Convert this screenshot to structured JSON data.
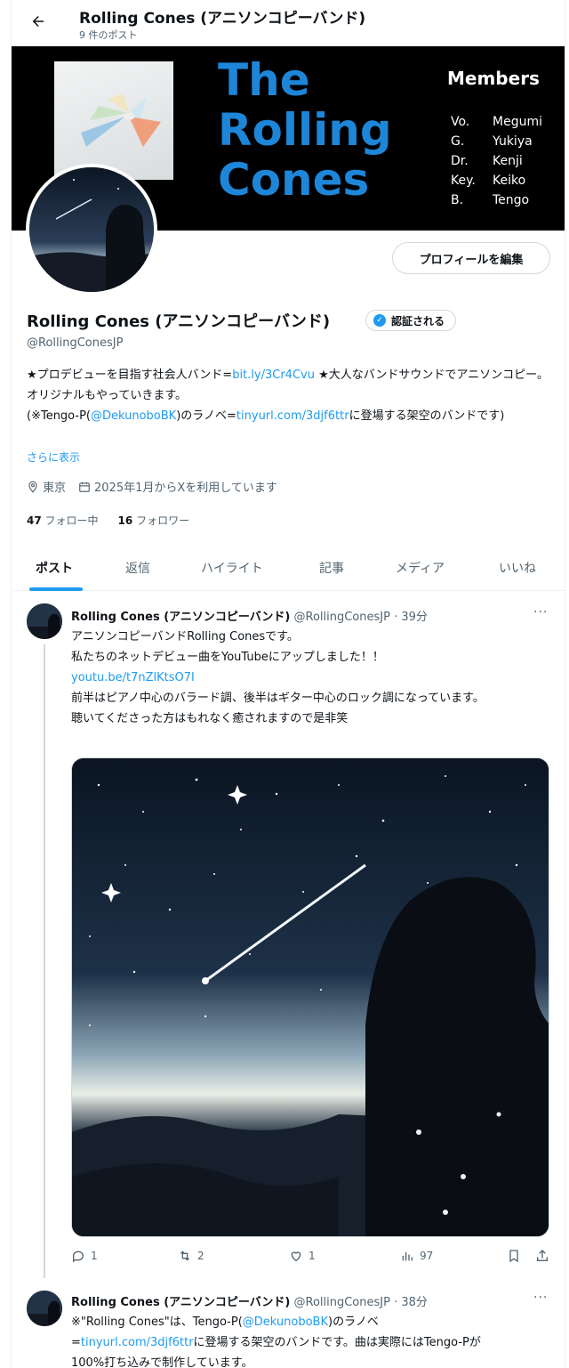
{
  "header": {
    "title": "Rolling Cones (アニソンコピーバンド)",
    "post_count": "9 件のポスト"
  },
  "banner": {
    "band_lines": [
      "The",
      "Rolling",
      "Cones"
    ],
    "members_heading": "Members",
    "members": [
      {
        "role": "Vo.",
        "name": "Megumi"
      },
      {
        "role": "G.",
        "name": "Yukiya"
      },
      {
        "role": "Dr.",
        "name": "Kenji"
      },
      {
        "role": "Key.",
        "name": "Keiko"
      },
      {
        "role": "B.",
        "name": "Tengo"
      }
    ]
  },
  "profile": {
    "edit_label": "プロフィールを編集",
    "name": "Rolling Cones (アニソンコピーバンド)",
    "verify_label": "認証される",
    "handle": "@RollingConesJP",
    "bio": {
      "p1": "★プロデビューを目指す社会人バンド=",
      "link1": "bit.ly/3Cr4Cvu",
      "p2": " ★大人なバンドサウンドでアニソンコピー。オリジナルもやっていきます。",
      "p3": "(※Tengo-P(",
      "mention": "@DekunoboBK",
      "p4": ")のラノベ=",
      "link2": "tinyurl.com/3djf6ttr",
      "p5": "に登場する架空のバンドです)"
    },
    "show_more": "さらに表示",
    "location": "東京",
    "joined": "2025年1月からXを利用しています",
    "following_count": "47",
    "following_label": "フォロー中",
    "followers_count": "16",
    "followers_label": "フォロワー"
  },
  "tabs": [
    "ポスト",
    "返信",
    "ハイライト",
    "記事",
    "メディア",
    "いいね"
  ],
  "tweets": [
    {
      "name": "Rolling Cones (アニソンコピーバンド)",
      "handle_time": "@RollingConesJP · 39分",
      "line1": "アニソンコピーバンドRolling Conesです。",
      "line2": "私たちのネットデビュー曲をYouTubeにアップしました！！",
      "link": "youtu.be/t7nZlKtsO7I",
      "line3": "前半はピアノ中心のバラード調、後半はギター中心のロック調になっています。",
      "line4": "聴いてくださった方はもれなく癒されますので是非笑",
      "replies": "1",
      "reposts": "2",
      "likes": "1",
      "views": "97"
    },
    {
      "name": "Rolling Cones (アニソンコピーバンド)",
      "handle_time": "@RollingConesJP · 38分",
      "t1": "※\"Rolling Cones\"は、Tengo-P(",
      "mention": "@DekunoboBK",
      "t2": ")のラノベ",
      "t3": "=",
      "link": "tinyurl.com/3djf6ttr",
      "t4": "に登場する架空のバンドです。曲は実際にはTengo-Pが",
      "t5": "100%打ち込みで制作しています。"
    }
  ],
  "colors": {
    "accent": "#1d9bf0",
    "band_title": "#1e86d8",
    "text": "#0f1419",
    "muted": "#536471"
  }
}
